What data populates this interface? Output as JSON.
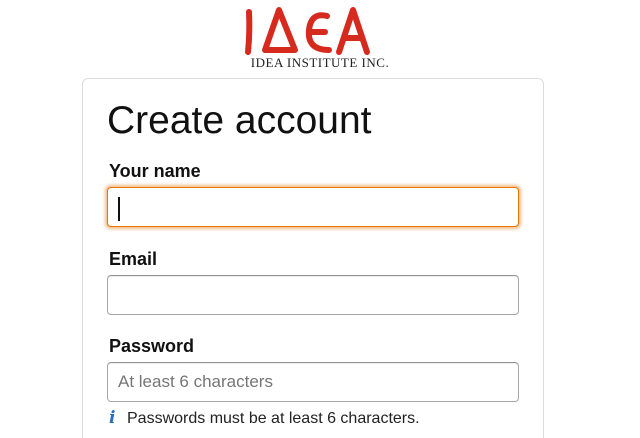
{
  "brand": {
    "logo_name": "IDEA",
    "company": "IDEA INSTITUTE INC.",
    "logo_color": "#d62a1f"
  },
  "form": {
    "title": "Create account",
    "name": {
      "label": "Your name",
      "value": "",
      "placeholder": ""
    },
    "email": {
      "label": "Email",
      "value": "",
      "placeholder": ""
    },
    "password": {
      "label": "Password",
      "value": "",
      "placeholder": "At least 6 characters",
      "hint_icon": "info-icon",
      "hint": "Passwords must be at least 6 characters."
    }
  },
  "colors": {
    "focus_border": "#e77600",
    "info_icon": "#2a6fb7"
  }
}
